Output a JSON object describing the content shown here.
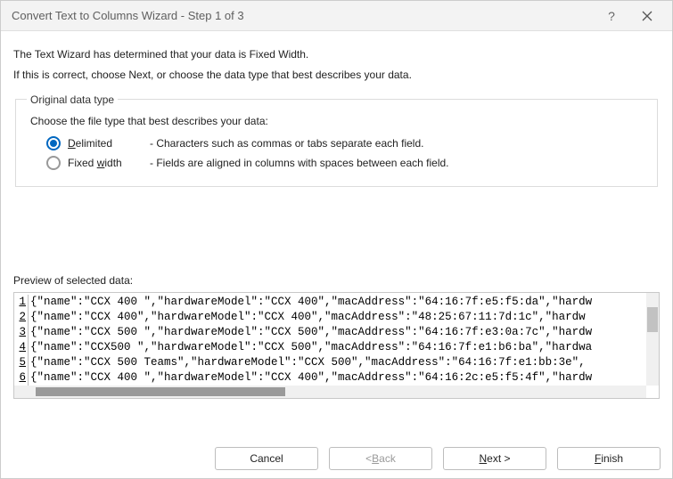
{
  "title": "Convert Text to Columns Wizard - Step 1 of 3",
  "intro1": "The Text Wizard has determined that your data is Fixed Width.",
  "intro2": "If this is correct, choose Next, or choose the data type that best describes your data.",
  "group": {
    "legend": "Original data type",
    "choose": "Choose the file type that best describes your data:",
    "delimited": {
      "label_before": "",
      "label_ul": "D",
      "label_after": "elimited",
      "desc": "- Characters such as commas or tabs separate each field.",
      "checked": true
    },
    "fixed": {
      "label_before": "Fixed ",
      "label_ul": "w",
      "label_after": "idth",
      "desc": "- Fields are aligned in columns with spaces between each field.",
      "checked": false
    }
  },
  "preview_label": "Preview of selected data:",
  "preview_rows": [
    {
      "n": "1",
      "t": "{\"name\":\"CCX 400 \",\"hardwareModel\":\"CCX 400\",\"macAddress\":\"64:16:7f:e5:f5:da\",\"hardw"
    },
    {
      "n": "2",
      "t": "{\"name\":\"CCX 400\",\"hardwareModel\":\"CCX 400\",\"macAddress\":\"48:25:67:11:7d:1c\",\"hardw"
    },
    {
      "n": "3",
      "t": "{\"name\":\"CCX 500 \",\"hardwareModel\":\"CCX 500\",\"macAddress\":\"64:16:7f:e3:0a:7c\",\"hardw"
    },
    {
      "n": "4",
      "t": "{\"name\":\"CCX500 \",\"hardwareModel\":\"CCX 500\",\"macAddress\":\"64:16:7f:e1:b6:ba\",\"hardwa"
    },
    {
      "n": "5",
      "t": "{\"name\":\"CCX 500  Teams\",\"hardwareModel\":\"CCX 500\",\"macAddress\":\"64:16:7f:e1:bb:3e\","
    },
    {
      "n": "6",
      "t": "{\"name\":\"CCX 400 \",\"hardwareModel\":\"CCX 400\",\"macAddress\":\"64:16:2c:e5:f5:4f\",\"hardw"
    }
  ],
  "buttons": {
    "cancel": "Cancel",
    "back_lt": "< ",
    "back_ul": "B",
    "back_after": "ack",
    "next_ul": "N",
    "next_after": "ext >",
    "finish_ul": "F",
    "finish_after": "inish"
  }
}
